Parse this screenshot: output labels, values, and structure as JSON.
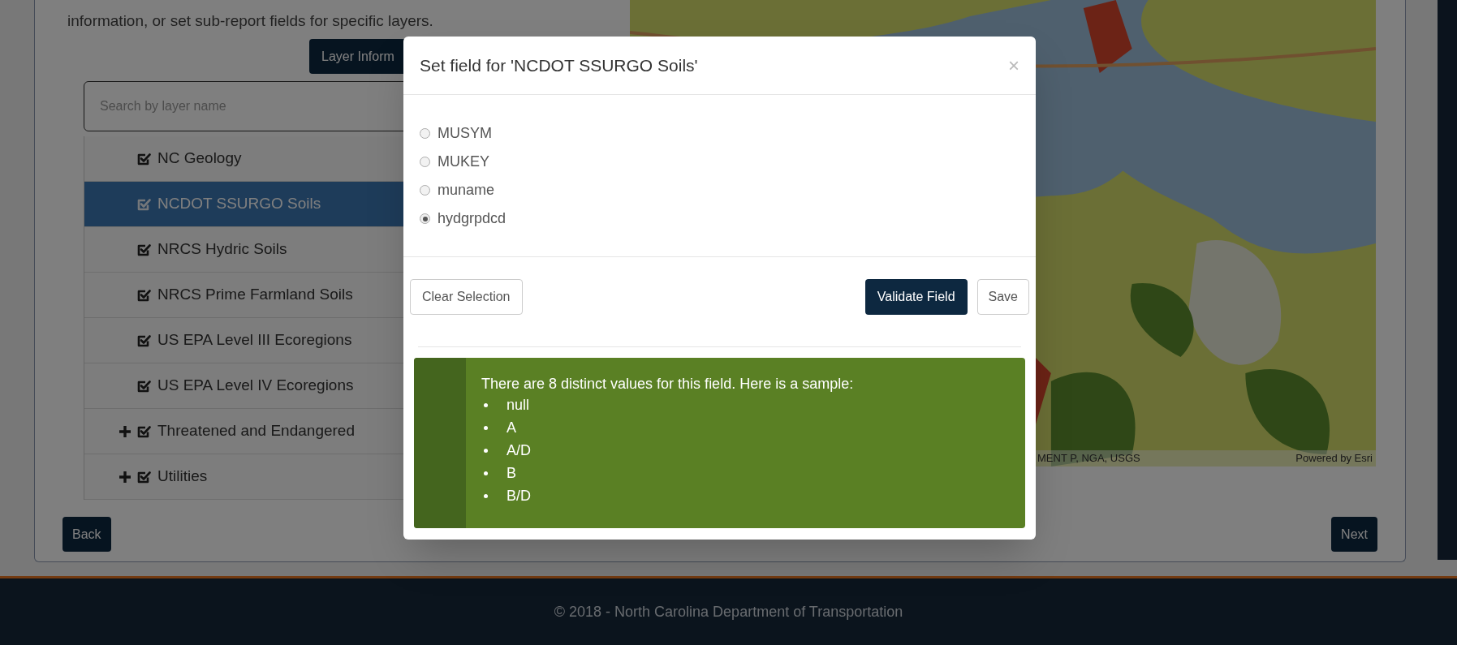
{
  "intro": {
    "text": "information, or set sub-report fields for specific layers."
  },
  "layer_info_button": {
    "label": "Layer Inform"
  },
  "search": {
    "placeholder": "Search by layer name"
  },
  "layers": [
    {
      "label": "NC Geology",
      "checked": true,
      "selected": false,
      "expandable": false
    },
    {
      "label": "NCDOT SSURGO Soils",
      "checked": true,
      "selected": true,
      "expandable": false
    },
    {
      "label": "NRCS Hydric Soils",
      "checked": true,
      "selected": false,
      "expandable": false
    },
    {
      "label": "NRCS Prime Farmland Soils",
      "checked": true,
      "selected": false,
      "expandable": false
    },
    {
      "label": "US EPA Level III Ecoregions",
      "checked": true,
      "selected": false,
      "expandable": false
    },
    {
      "label": "US EPA Level IV Ecoregions",
      "checked": true,
      "selected": false,
      "expandable": false
    },
    {
      "label": "Threatened and Endangered",
      "checked": true,
      "selected": false,
      "expandable": true
    },
    {
      "label": "Utilities",
      "checked": true,
      "selected": false,
      "expandable": true
    }
  ],
  "nav": {
    "back": "Back",
    "next": "Next"
  },
  "map": {
    "attribution": "MENT P, NGA, USGS",
    "powered_by": "Powered by Esri"
  },
  "modal": {
    "title": "Set field for 'NCDOT SSURGO Soils'",
    "close": "×",
    "fields": [
      {
        "label": "MUSYM",
        "selected": false
      },
      {
        "label": "MUKEY",
        "selected": false
      },
      {
        "label": "muname",
        "selected": false
      },
      {
        "label": "hydgrpdcd",
        "selected": true
      }
    ],
    "buttons": {
      "clear": "Clear Selection",
      "validate": "Validate Field",
      "save": "Save"
    },
    "alert": {
      "text": "There are 8 distinct values for this field. Here is a sample:",
      "samples": [
        "null",
        "A",
        "A/D",
        "B",
        "B/D"
      ]
    }
  },
  "footer": {
    "text": "© 2018 - North Carolina Department of Transportation"
  }
}
